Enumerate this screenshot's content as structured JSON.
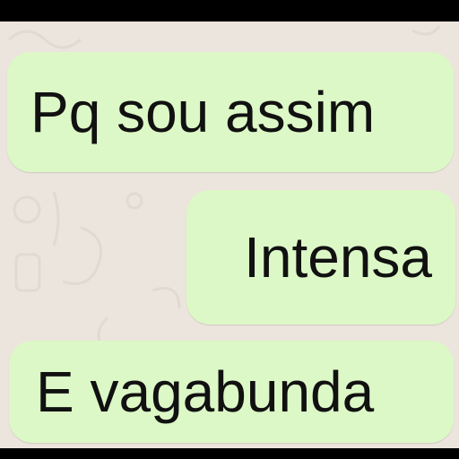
{
  "chat": {
    "background_color": "#ece5dd",
    "bubble_color": "#dcf8c6",
    "messages": [
      {
        "text": "Pq sou assim"
      },
      {
        "text": "Intensa"
      },
      {
        "text": "E vagabunda"
      }
    ]
  }
}
